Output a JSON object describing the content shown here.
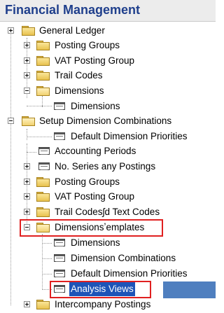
{
  "title": "Financial Management",
  "tree": [
    {
      "id": "general-ledger",
      "label": "General Ledger"
    },
    {
      "id": "posting-groups-1",
      "label": "Posting Groups"
    },
    {
      "id": "vat-posting-group-1",
      "label": "VAT Posting Group"
    },
    {
      "id": "trail-codes-1",
      "label": "Trail Codes"
    },
    {
      "id": "dimensions-folder-1",
      "label": "Dimensions"
    },
    {
      "id": "dimensions-item-1",
      "label": "Dimensions"
    },
    {
      "id": "setup",
      "label": "Setup  Dimension Combinations"
    },
    {
      "id": "default-dimension-priorities-1",
      "label": "Default Dimension Priorities"
    },
    {
      "id": "accounting-periods",
      "label": "Accounting Periods"
    },
    {
      "id": "no-series",
      "label": "No. Series any Postings"
    },
    {
      "id": "posting-groups-2",
      "label": "Posting Groups"
    },
    {
      "id": "vat-posting-group-2",
      "label": "VAT Posting Group"
    },
    {
      "id": "trail-codes-2",
      "label": "Trail Codesʃd Text Codes"
    },
    {
      "id": "dimensions-templates",
      "label": "Dimensionsʼemplates"
    },
    {
      "id": "dimensions-item-2",
      "label": "Dimensions"
    },
    {
      "id": "dimension-combinations",
      "label": "Dimension Combinations"
    },
    {
      "id": "default-dimension-priorities-2",
      "label": "Default Dimension Priorities"
    },
    {
      "id": "analysis-views",
      "label": "Analysis Views"
    },
    {
      "id": "intercompany-postings",
      "label": "Intercompany Postings"
    }
  ]
}
